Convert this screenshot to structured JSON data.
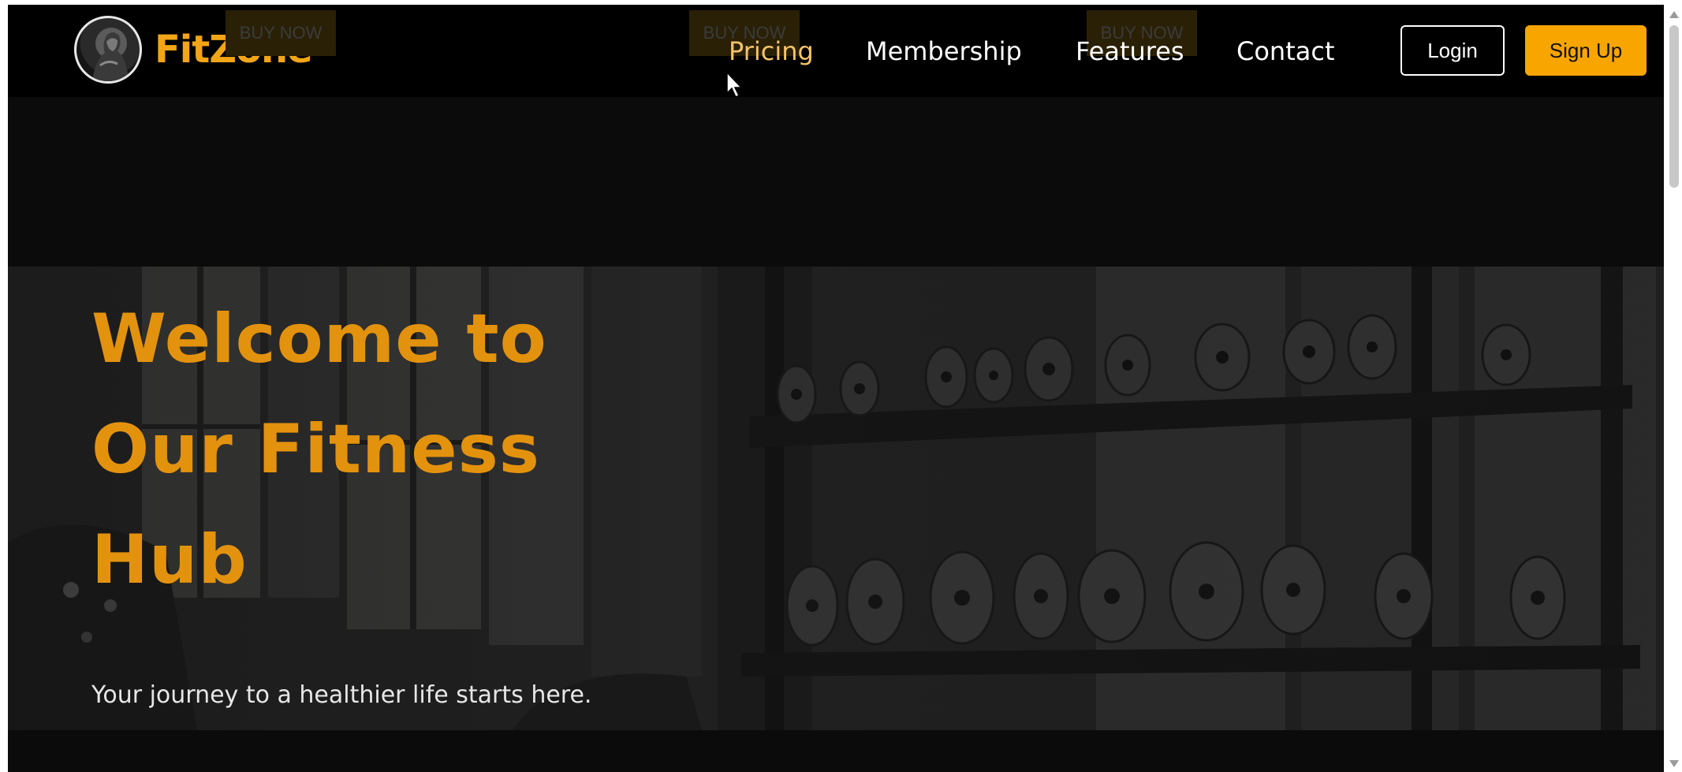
{
  "nav": {
    "brand": "FitZone",
    "ghost_buttons": [
      "BUY NOW",
      "BUY NOW",
      "BUY NOW"
    ],
    "menu": [
      {
        "label": "Pricing",
        "active": true
      },
      {
        "label": "Membership"
      },
      {
        "label": "Features"
      },
      {
        "label": "Contact"
      }
    ],
    "login_label": "Login",
    "signup_label": "Sign Up"
  },
  "hero": {
    "title_lines": [
      "Welcome to",
      "Our Fitness",
      "Hub"
    ],
    "subtitle": "Your journey to a healthier life starts here."
  },
  "colors": {
    "accent": "#f8a500",
    "brand": "#f2a516",
    "hero_title": "#e3920e",
    "nav_bg": "#000000",
    "page_bg": "#0b0b0b"
  },
  "icons": {
    "logo": "athlete-avatar-icon",
    "cursor": "mouse-pointer-icon"
  }
}
